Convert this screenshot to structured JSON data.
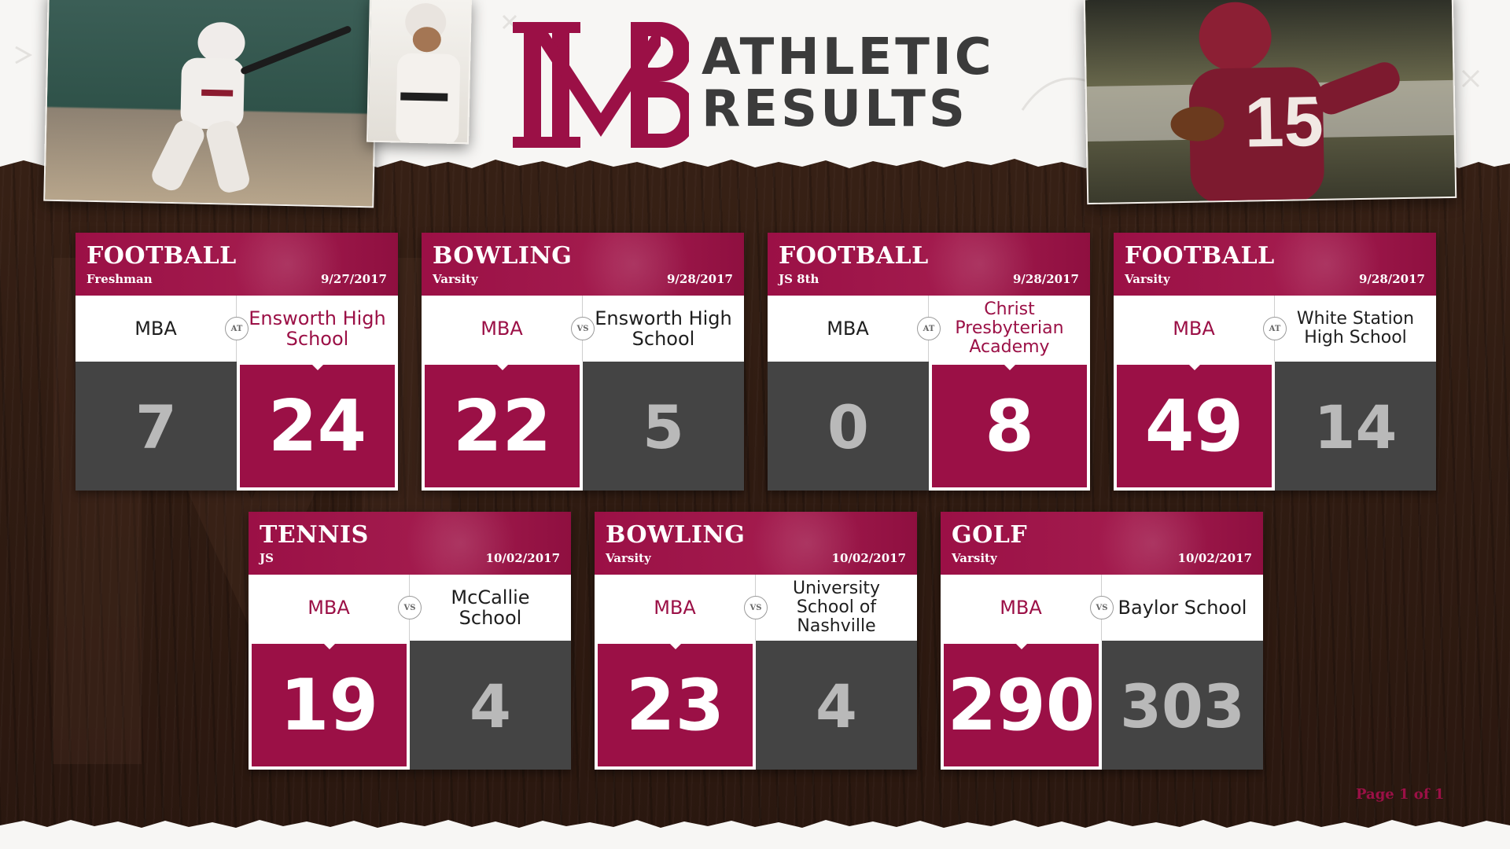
{
  "header": {
    "logo_text": "MB",
    "title_line1": "ATHLETIC",
    "title_line2": "RESULTS"
  },
  "colors": {
    "brand": "#9b1046",
    "score_bg": "#444444",
    "wood": "#2e1a12"
  },
  "results": [
    {
      "sport": "FOOTBALL",
      "level": "Freshman",
      "date": "9/27/2017",
      "separator": "AT",
      "home": "MBA",
      "away": "Ensworth High School",
      "home_score": "7",
      "away_score": "24",
      "winner": "away"
    },
    {
      "sport": "BOWLING",
      "level": "Varsity",
      "date": "9/28/2017",
      "separator": "VS",
      "home": "MBA",
      "away": "Ensworth High School",
      "home_score": "22",
      "away_score": "5",
      "winner": "home"
    },
    {
      "sport": "FOOTBALL",
      "level": "JS 8th",
      "date": "9/28/2017",
      "separator": "AT",
      "home": "MBA",
      "away": "Christ Presbyterian Academy",
      "home_score": "0",
      "away_score": "8",
      "winner": "away"
    },
    {
      "sport": "FOOTBALL",
      "level": "Varsity",
      "date": "9/28/2017",
      "separator": "AT",
      "home": "MBA",
      "away": "White Station High School",
      "home_score": "49",
      "away_score": "14",
      "winner": "home"
    },
    {
      "sport": "TENNIS",
      "level": "JS",
      "date": "10/02/2017",
      "separator": "VS",
      "home": "MBA",
      "away": "McCallie School",
      "home_score": "19",
      "away_score": "4",
      "winner": "home"
    },
    {
      "sport": "BOWLING",
      "level": "Varsity",
      "date": "10/02/2017",
      "separator": "VS",
      "home": "MBA",
      "away": "University School of Nashville",
      "home_score": "23",
      "away_score": "4",
      "winner": "home"
    },
    {
      "sport": "GOLF",
      "level": "Varsity",
      "date": "10/02/2017",
      "separator": "VS",
      "home": "MBA",
      "away": "Baylor School",
      "home_score": "290",
      "away_score": "303",
      "winner": "home"
    }
  ],
  "pagination": {
    "label": "Page 1 of 1"
  }
}
